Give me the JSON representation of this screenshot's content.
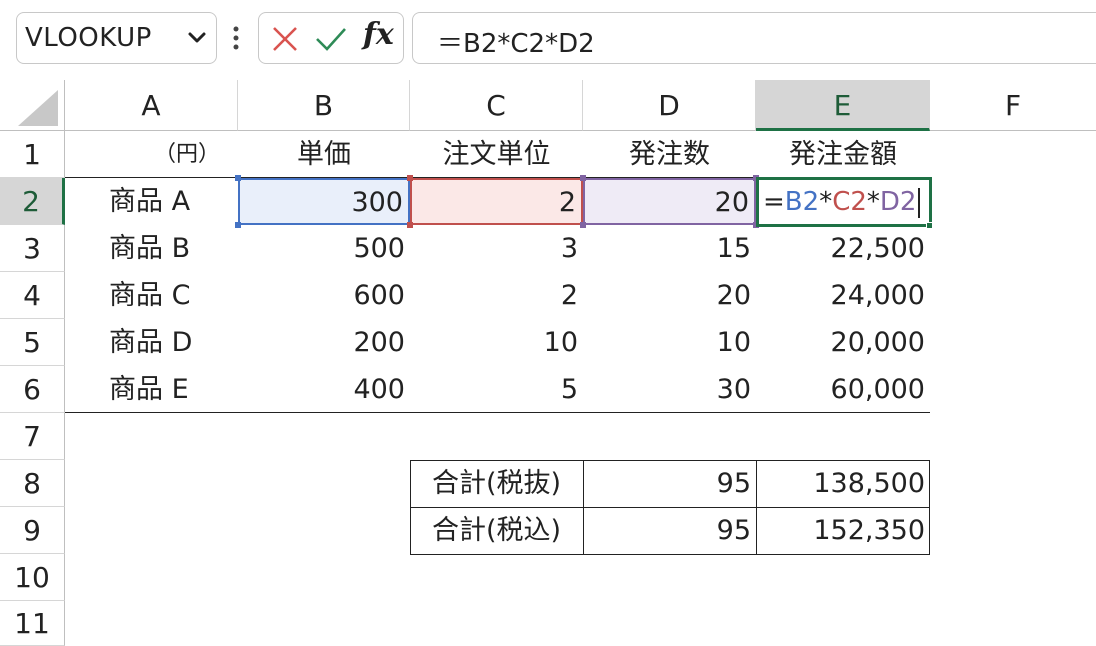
{
  "name_box": {
    "value": "VLOOKUP"
  },
  "formula_bar": {
    "value": "＝B2*C2*D2"
  },
  "colors": {
    "ref_b": "#4472c4",
    "ref_c": "#c0504d",
    "ref_d": "#8064a2",
    "select": "#1e7145"
  },
  "columns": [
    "A",
    "B",
    "C",
    "D",
    "E",
    "F"
  ],
  "rows": [
    "1",
    "2",
    "3",
    "4",
    "5",
    "6",
    "7",
    "8",
    "9",
    "10",
    "11"
  ],
  "header_row": {
    "unit": "（円）",
    "price": "単価",
    "order_unit": "注文単位",
    "order_qty": "発注数",
    "order_amount": "発注金額"
  },
  "data_rows": [
    {
      "name": "商品 A",
      "price": "300",
      "unit": "2",
      "qty": "20",
      "amount": ""
    },
    {
      "name": "商品 B",
      "price": "500",
      "unit": "3",
      "qty": "15",
      "amount": "22,500"
    },
    {
      "name": "商品 C",
      "price": "600",
      "unit": "2",
      "qty": "20",
      "amount": "24,000"
    },
    {
      "name": "商品 D",
      "price": "200",
      "unit": "10",
      "qty": "10",
      "amount": "20,000"
    },
    {
      "name": "商品 E",
      "price": "400",
      "unit": "5",
      "qty": "30",
      "amount": "60,000"
    }
  ],
  "edit_formula": {
    "eq": "=",
    "b": "B2",
    "star1": "*",
    "c": "C2",
    "star2": "*",
    "d": "D2"
  },
  "totals": [
    {
      "label": "合計(税抜)",
      "qty": "95",
      "amount": "138,500"
    },
    {
      "label": "合計(税込)",
      "qty": "95",
      "amount": "152,350"
    }
  ]
}
